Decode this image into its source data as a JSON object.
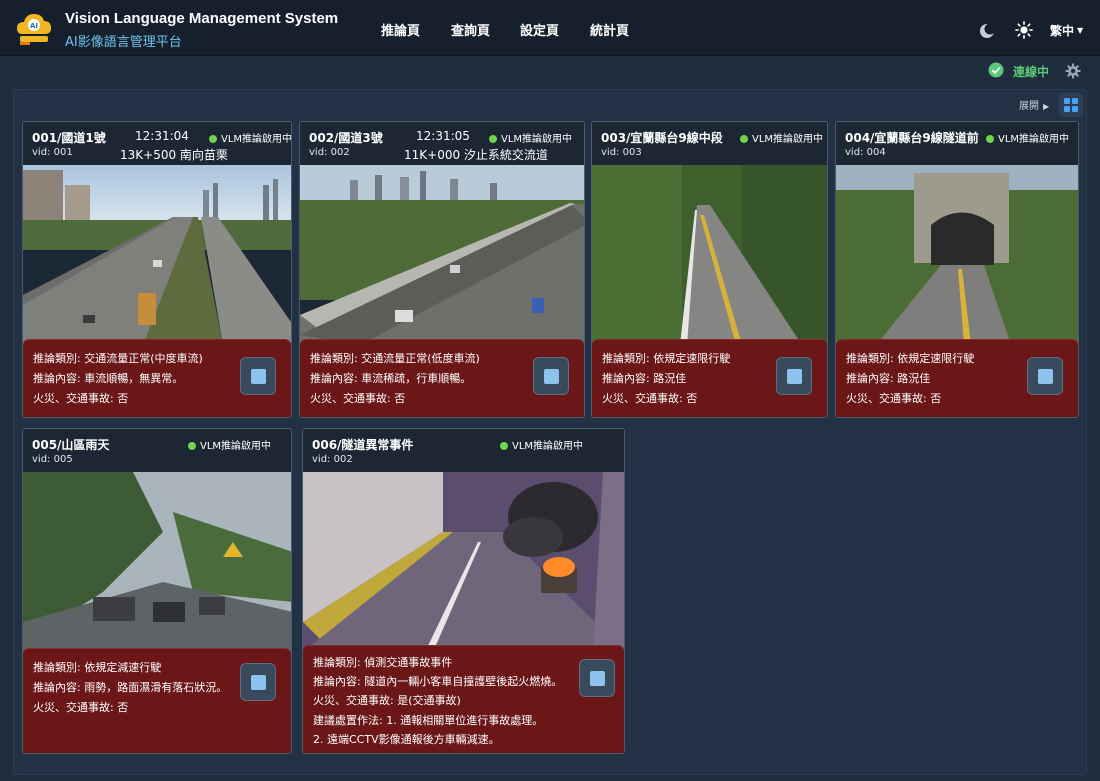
{
  "app": {
    "title": "Vision Language Management System",
    "subtitle": "AI影像語言管理平台"
  },
  "nav": {
    "items": [
      {
        "label": "推論頁"
      },
      {
        "label": "查詢頁"
      },
      {
        "label": "設定頁"
      },
      {
        "label": "統計頁"
      }
    ]
  },
  "header_controls": {
    "theme_dark_icon": "moon-icon",
    "theme_light_icon": "sun-icon",
    "language": "繁中"
  },
  "connection": {
    "status": "連線中",
    "status_color": "#5bc97a"
  },
  "toolbar": {
    "expand_label": "展開",
    "grid_icon": "grid-icon"
  },
  "colors": {
    "accent": "#4aa3f0",
    "alert_panel": "#6c1717",
    "vlm_dot": "#6cd64e"
  },
  "cameras": [
    {
      "name": "001/國道1號",
      "time": "12:31:04",
      "vid": "vid: 001",
      "location": "13K+500 南向苗栗",
      "vlm_status": "VLM推論啟用中",
      "lines": [
        "推論類別: 交通流量正常(中度車流)",
        "推論內容: 車流順暢，無異常。",
        "火災、交通事故: 否"
      ]
    },
    {
      "name": "002/國道3號",
      "time": "12:31:05",
      "vid": "vid: 002",
      "location": "11K+000 汐止系統交流道",
      "vlm_status": "VLM推論啟用中",
      "lines": [
        "推論類別: 交通流量正常(低度車流)",
        "推論內容: 車流稀疏，行車順暢。",
        "火災、交通事故: 否"
      ]
    },
    {
      "name": "003/宜蘭縣台9線中段",
      "time": "",
      "vid": "vid: 003",
      "location": "",
      "vlm_status": "VLM推論啟用中",
      "lines": [
        "推論類別: 依規定速限行駛",
        "推論內容: 路況佳",
        "火災、交通事故: 否"
      ]
    },
    {
      "name": "004/宜蘭縣台9線隧道前",
      "time": "",
      "vid": "vid: 004",
      "location": "",
      "vlm_status": "VLM推論啟用中",
      "lines": [
        "推論類別: 依規定速限行駛",
        "推論內容: 路況佳",
        "火災、交通事故: 否"
      ]
    },
    {
      "name": "005/山區雨天",
      "time": "",
      "vid": "vid: 005",
      "location": "",
      "vlm_status": "VLM推論啟用中",
      "lines": [
        "推論類別: 依規定減速行駛",
        "推論內容: 雨勢，路面濕滑有落石狀況。",
        "火災、交通事故: 否"
      ]
    },
    {
      "name": "006/隧道異常事件",
      "time": "",
      "vid": "vid: 002",
      "location": "",
      "vlm_status": "VLM推論啟用中",
      "lines": [
        "推論類別: 偵測交通事故事件",
        "推論內容: 隧道內一輛小客車自撞護壁後起火燃燒。",
        "火災、交通事故: 是(交通事故)",
        "建議處置作法: 1.  通報相關單位進行事故處理。",
        "                          2.  遠端CCTV影像通報後方車輛減速。"
      ]
    }
  ]
}
